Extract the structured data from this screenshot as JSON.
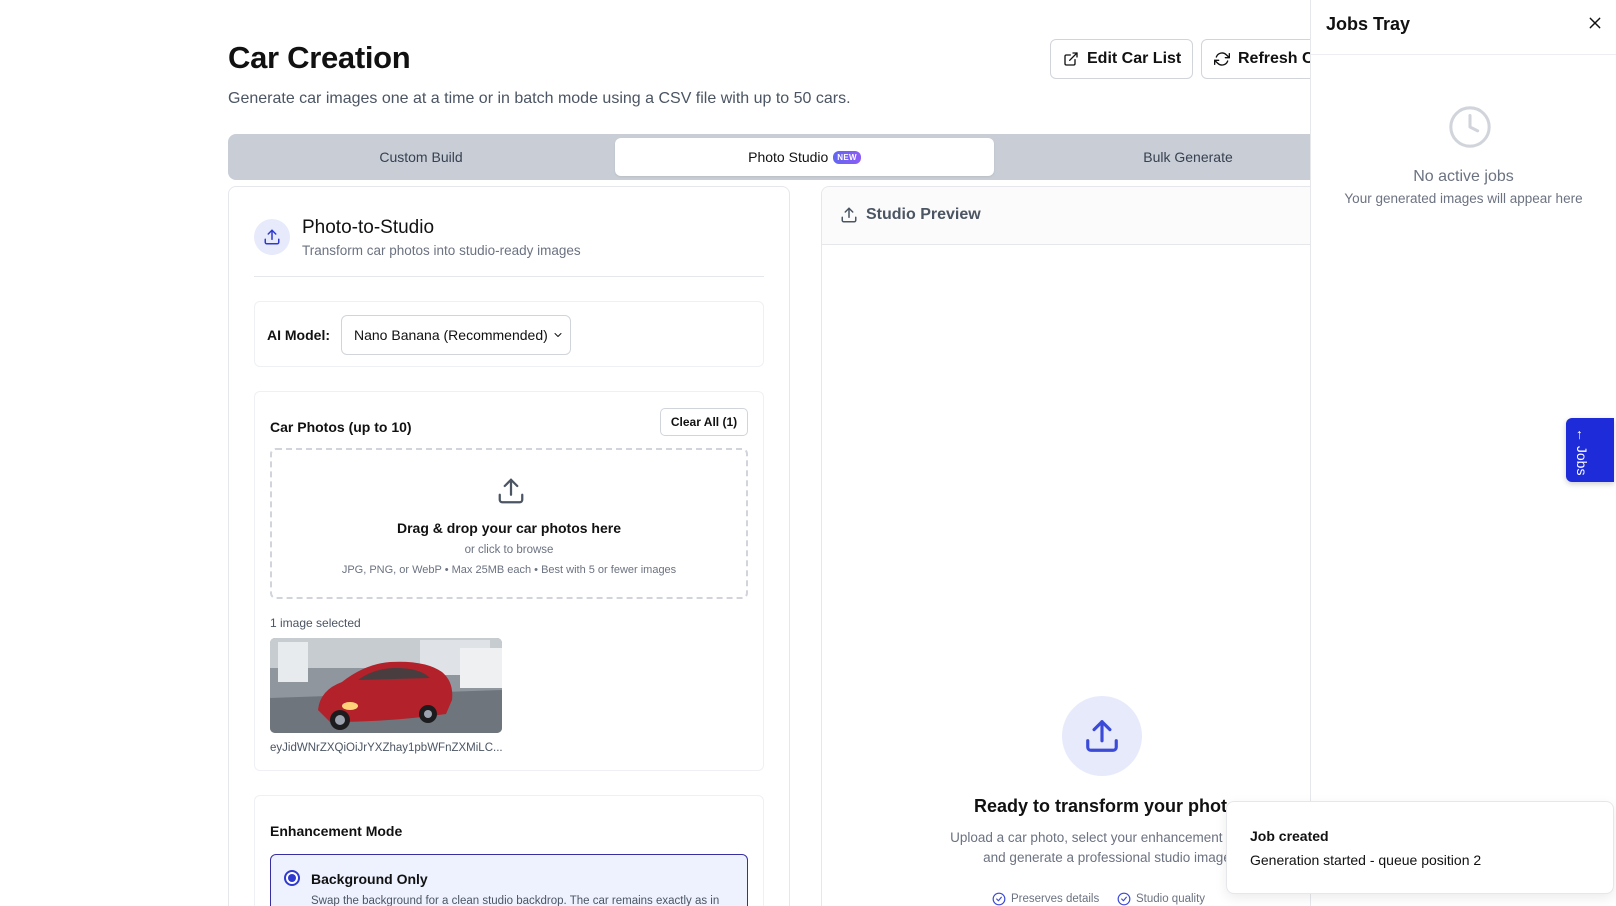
{
  "page": {
    "title": "Car Creation",
    "subtitle": "Generate car images one at a time or in batch mode using a CSV file with up to 50 cars."
  },
  "header_actions": {
    "edit_label": "Edit Car List",
    "refresh_label": "Refresh C"
  },
  "tabs": [
    {
      "label": "Custom Build",
      "active": false
    },
    {
      "label": "Photo Studio",
      "active": true,
      "badge": "NEW"
    },
    {
      "label": "Bulk Generate",
      "active": false
    }
  ],
  "photo_to_studio": {
    "title": "Photo-to-Studio",
    "subtitle": "Transform car photos into studio-ready images"
  },
  "model": {
    "label": "AI Model:",
    "selected": "Nano Banana (Recommended)"
  },
  "photos": {
    "title": "Car Photos (up to 10)",
    "clear_label": "Clear All (1)",
    "drop_title": "Drag & drop your car photos here",
    "drop_sub": "or click to browse",
    "drop_hint": "JPG, PNG, or WebP • Max 25MB each • Best with 5 or fewer images",
    "selected_count": "1 image selected",
    "thumb_name": "eyJidWNrZXQiOiJrYXZhay1pbWFnZXMiLC..."
  },
  "enhancement": {
    "title": "Enhancement Mode",
    "option_title": "Background Only",
    "option_desc": "Swap the background for a clean studio backdrop. The car remains exactly as in"
  },
  "preview": {
    "title": "Studio Preview",
    "ready_title": "Ready to transform your photo",
    "ready_desc": "Upload a car photo, select your enhancement mode, and generate a professional studio image",
    "feature_1": "Preserves details",
    "feature_2": "Studio quality"
  },
  "jobs_tray": {
    "title": "Jobs Tray",
    "empty_title": "No active jobs",
    "empty_sub": "Your generated images will appear here",
    "tab_label": "← Jobs"
  },
  "toast": {
    "title": "Job created",
    "description": "Generation started - queue position 2"
  },
  "colors": {
    "accent": "#2f3ad0",
    "accent_soft": "#e7eafb",
    "tab_bar": "#c9ced6",
    "car_red": "#b3212a"
  },
  "icons": [
    "external-link-icon",
    "refresh-icon",
    "upload-icon",
    "chevron-down-icon",
    "check-circle-icon",
    "close-icon",
    "clock-icon"
  ]
}
